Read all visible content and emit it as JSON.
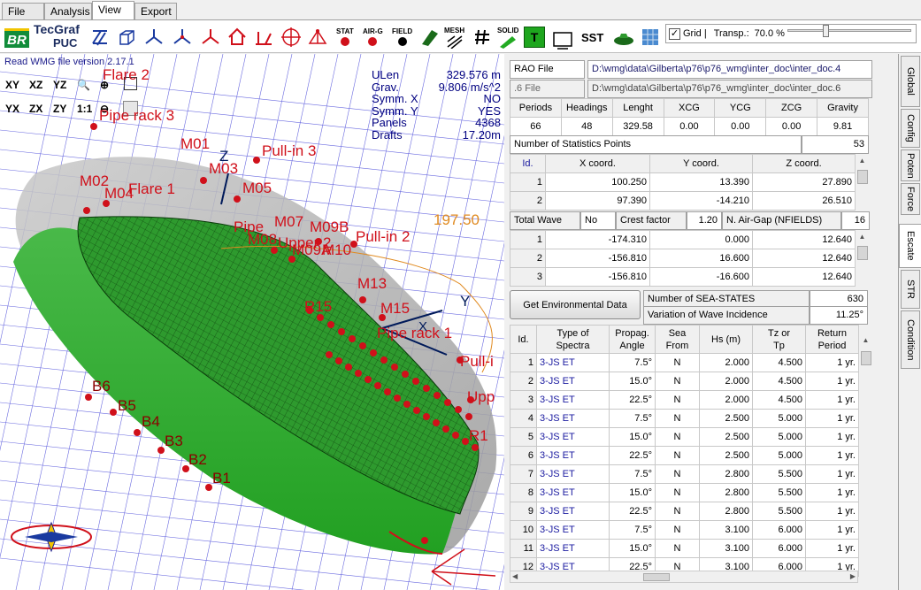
{
  "menu": {
    "tabs": [
      {
        "label": "File"
      },
      {
        "label": "Analysis"
      },
      {
        "label": "View"
      },
      {
        "label": "Export"
      }
    ]
  },
  "toolbar": {
    "logo_br": "BR",
    "logo_tecgraf": "TecGraf",
    "logo_puc": "PUC",
    "tools": [
      {
        "label": "STAT"
      },
      {
        "label": "AIR-G"
      },
      {
        "label": "FIELD"
      },
      {
        "label": "MESH"
      },
      {
        "label": "SOLID"
      }
    ],
    "sst_label": "SST",
    "t_label": "T",
    "grid_label": "Grid |",
    "grid_checked": "✓",
    "transp_label": "Transp.:",
    "transp_value": "70.0 %",
    "transp_fraction": 0.3
  },
  "viewport": {
    "status": "Read WMG file version 2.17.1",
    "view_buttons": [
      "XY",
      "XZ",
      "YZ",
      "YX",
      "ZX",
      "ZY",
      "1:1"
    ],
    "info": [
      {
        "k": "ULen",
        "v": "329.576 m"
      },
      {
        "k": "Grav.",
        "v": "9.806 m/s^2"
      },
      {
        "k": "Symm. X",
        "v": "NO"
      },
      {
        "k": "Symm. Y",
        "v": "YES"
      },
      {
        "k": "Panels",
        "v": "4368"
      },
      {
        "k": "Drafts",
        "v": "17.20m"
      }
    ],
    "heading_value": "197.50",
    "axis_x": "X",
    "axis_y": "Y",
    "axis_z": "Z",
    "labels": [
      "Flare 2",
      "Pipe rack 3",
      "M01",
      "Pull-in 3",
      "M03",
      "M02",
      "M04",
      "Flare 1",
      "M05",
      "Pipe",
      "M07",
      "M09B",
      "M08",
      "Upper 2",
      "M09A",
      "Pull-in 2",
      "M10",
      "M13",
      "M15",
      "R15",
      "Pipe rack 1",
      "Pull-i",
      "Upp",
      "B6",
      "B5",
      "B4",
      "B3",
      "B2",
      "B1",
      "R1"
    ]
  },
  "rao": {
    "rao_label": "RAO File",
    "rao_path": "D:\\wmg\\data\\Gilberta\\p76\\p76_wmg\\inter_doc\\inter_doc.4",
    "six_label": ".6 File",
    "six_path": "D:\\wmg\\data\\Gilberta\\p76\\p76_wmg\\inter_doc\\inter_doc.6",
    "headers": [
      "Periods",
      "Headings",
      "Lenght",
      "XCG",
      "YCG",
      "ZCG",
      "Gravity"
    ],
    "values": [
      "66",
      "48",
      "329.58",
      "0.00",
      "0.00",
      "0.00",
      "9.81"
    ]
  },
  "stat_points": {
    "label": "Number of Statistics Points",
    "count": "53",
    "headers": [
      "Id.",
      "X coord.",
      "Y coord.",
      "Z coord."
    ],
    "rows": [
      [
        "1",
        "100.250",
        "13.390",
        "27.890"
      ],
      [
        "2",
        "97.390",
        "-14.210",
        "26.510"
      ]
    ]
  },
  "total_wave": {
    "label": "Total Wave",
    "value": "No",
    "crest_label": "Crest factor",
    "crest_value": "1.20",
    "nair_label": "N. Air-Gap (NFIELDS)",
    "nair_value": "16",
    "rows": [
      [
        "1",
        "-174.310",
        "0.000",
        "12.640"
      ],
      [
        "2",
        "-156.810",
        "16.600",
        "12.640"
      ],
      [
        "3",
        "-156.810",
        "-16.600",
        "12.640"
      ]
    ]
  },
  "env": {
    "button": "Get Environmental Data",
    "num_label": "Number of SEA-STATES",
    "num_value": "630",
    "var_label": "Variation of Wave Incidence",
    "var_value": "11.25°",
    "headers": [
      [
        "Id.",
        ""
      ],
      [
        "Type of",
        "Spectra"
      ],
      [
        "Propag.",
        "Angle"
      ],
      [
        "Sea",
        "From"
      ],
      [
        "Hs (m)",
        ""
      ],
      [
        "Tz or",
        "Tp"
      ],
      [
        "Return",
        "Period"
      ]
    ],
    "rows": [
      [
        "1",
        "3-JS ET",
        "7.5°",
        "N",
        "2.000",
        "4.500",
        "1 yr."
      ],
      [
        "2",
        "3-JS ET",
        "15.0°",
        "N",
        "2.000",
        "4.500",
        "1 yr."
      ],
      [
        "3",
        "3-JS ET",
        "22.5°",
        "N",
        "2.000",
        "4.500",
        "1 yr."
      ],
      [
        "4",
        "3-JS ET",
        "7.5°",
        "N",
        "2.500",
        "5.000",
        "1 yr."
      ],
      [
        "5",
        "3-JS ET",
        "15.0°",
        "N",
        "2.500",
        "5.000",
        "1 yr."
      ],
      [
        "6",
        "3-JS ET",
        "22.5°",
        "N",
        "2.500",
        "5.000",
        "1 yr."
      ],
      [
        "7",
        "3-JS ET",
        "7.5°",
        "N",
        "2.800",
        "5.500",
        "1 yr."
      ],
      [
        "8",
        "3-JS ET",
        "15.0°",
        "N",
        "2.800",
        "5.500",
        "1 yr."
      ],
      [
        "9",
        "3-JS ET",
        "22.5°",
        "N",
        "2.800",
        "5.500",
        "1 yr."
      ],
      [
        "10",
        "3-JS ET",
        "7.5°",
        "N",
        "3.100",
        "6.000",
        "1 yr."
      ],
      [
        "11",
        "3-JS ET",
        "15.0°",
        "N",
        "3.100",
        "6.000",
        "1 yr."
      ],
      [
        "12",
        "3-JS ET",
        "22.5°",
        "N",
        "3.100",
        "6.000",
        "1 yr."
      ]
    ]
  },
  "sidetabs": [
    {
      "label": "Global"
    },
    {
      "label": "Config"
    },
    {
      "label": "Poten"
    },
    {
      "label": "Force"
    },
    {
      "label": "Escate"
    },
    {
      "label": "STR"
    },
    {
      "label": "Condition"
    }
  ],
  "colors": {
    "hull": "#2e9a2e",
    "mesh": "#0a3a0a",
    "labels": "#d0101a",
    "accent": "#1a1a8a"
  }
}
